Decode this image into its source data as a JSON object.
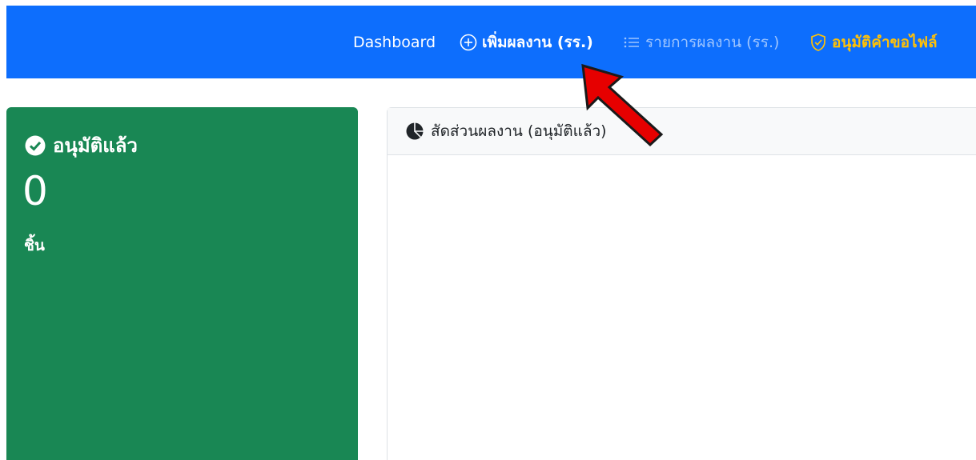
{
  "colors": {
    "nav_bg": "#0d6efd",
    "nav_active": "#ffc107",
    "card_success": "#198754",
    "arrow_red": "#e60000"
  },
  "navbar": {
    "items": [
      {
        "label": "Dashboard",
        "icon": ""
      },
      {
        "label": "เพิ่มผลงาน (รร.)",
        "icon": "plus-circle-icon"
      },
      {
        "label": "รายการผลงาน (รร.)",
        "icon": "list-icon"
      },
      {
        "label": "อนุมัติคำขอไฟล์",
        "icon": "shield-check-icon"
      }
    ]
  },
  "stat_card": {
    "title": "อนุมัติแล้ว",
    "icon": "check-circle-icon",
    "value": "0",
    "unit": "ชิ้น"
  },
  "chart_card": {
    "title": "สัดส่วนผลงาน (อนุมัติแล้ว)",
    "icon": "pie-chart-icon"
  },
  "annotation": {
    "icon": "red-arrow-icon"
  }
}
